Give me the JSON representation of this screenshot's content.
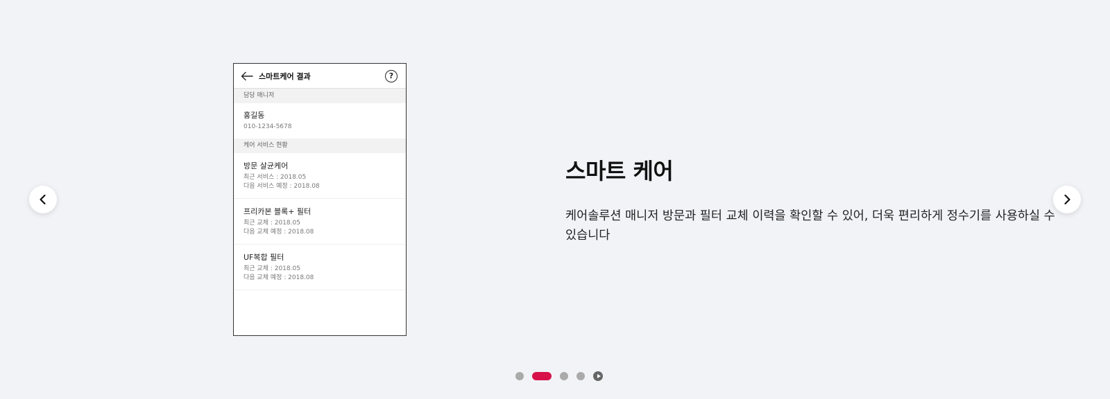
{
  "phone": {
    "title": "스마트케어 결과",
    "help_label": "?",
    "manager_section": "담당 매니저",
    "manager_name": "홍길동",
    "manager_phone": "010-1234-5678",
    "service_section": "케어 서비스 현황",
    "services": [
      {
        "title": "방문 살균케어",
        "line1": "최근 서비스 : 2018.05",
        "line2": "다음 서비스 예정 : 2018.08"
      },
      {
        "title": "프리카본 블록+ 필터",
        "line1": "최근 교체 : 2018.05",
        "line2": "다음 교체 예정 : 2018.08"
      },
      {
        "title": "UF복합 필터",
        "line1": "최근 교체 : 2018.05",
        "line2": "다음 교체 예정 : 2018.08"
      }
    ]
  },
  "copy": {
    "heading": "스마트 케어",
    "body": "케어솔루션 매니저 방문과 필터 교체 이력을 확인할 수 있어, 더욱 편리하게 정수기를 사용하실 수 있습니다"
  },
  "pager": {
    "active_index": 1,
    "count": 4
  },
  "colors": {
    "accent": "#d7114a",
    "background": "#f2f3f7"
  },
  "icons": {
    "prev": "chevron-left-icon",
    "next": "chevron-right-icon",
    "back": "arrow-left-icon",
    "help": "help-circle-icon",
    "play": "play-icon"
  }
}
